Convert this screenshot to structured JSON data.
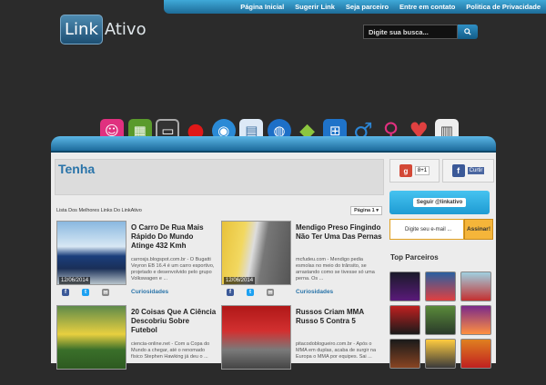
{
  "nav": {
    "items": [
      "Página Inicial",
      "Sugerir Link",
      "Seja parceiro",
      "Entre em contato",
      "Politica de Privacidade"
    ]
  },
  "logo": {
    "part1": "Link",
    "part2": "Ativo"
  },
  "search": {
    "placeholder": "Digite sua busca..."
  },
  "category_icons": [
    "pink-robot",
    "green-board",
    "tv",
    "mushroom",
    "blue-ball",
    "document",
    "globe",
    "android",
    "windows",
    "male",
    "female",
    "heart",
    "newspaper"
  ],
  "tenha": {
    "title": "Tenha"
  },
  "listing": {
    "caption": "Lista Dos Melhores Links Do LinkAtivo",
    "page_label": "Página 1"
  },
  "posts": [
    {
      "title": "O Carro De Rua Mais Rápido Do Mundo Atinge 432 Kmh",
      "date": "12/06/2014",
      "excerpt": "carrosjs.blogspot.com.br - O Bugatti Veyron EB 16.4 é um carro esportivo, projetado e desenvolvido pelo grupo Volkswagen e ...",
      "category": "Curiosidades"
    },
    {
      "title": "Mendigo Preso Fingindo Não Ter Uma Das Pernas",
      "date": "12/06/2014",
      "excerpt": "mcfudeu.com - Mendigo pedia esmolas no meio do trânsito, se arrastando como se tivesse só uma perna. Os ...",
      "category": "Curiosidades"
    },
    {
      "title": "20 Coisas Que A Ciência Descobriu Sobre Futebol",
      "date": "",
      "excerpt": "ciencia-online.net - Com a Copa do Mundo a chegar, até o renomado físico Stephen Hawking já deu o ...",
      "category": ""
    },
    {
      "title": "Russos Criam MMA Russo 5 Contra 5",
      "date": "",
      "excerpt": "pitacodoblogueiro.com.br - Após o MMA em duplas, acaba de surgir na Europa o MMA por equipes. Sai ...",
      "category": ""
    }
  ],
  "sidebar": {
    "gplus": "8+1",
    "facebook": "Curtir",
    "twitter": "Seguir @linkativo",
    "email_placeholder": "Digite seu e-mail ...",
    "subscribe": "Assinar!",
    "partners_title": "Top Parceiros",
    "partners": [
      "minilua",
      "partner-2",
      "partner-3",
      "partner-4",
      "partner-5",
      "partner-6",
      "partner-7",
      "partner-8",
      "portal-vip"
    ]
  },
  "colors": {
    "accent": "#2a74a9",
    "header_bg": "#2b2b2b",
    "bar": "#1c6a9b"
  }
}
